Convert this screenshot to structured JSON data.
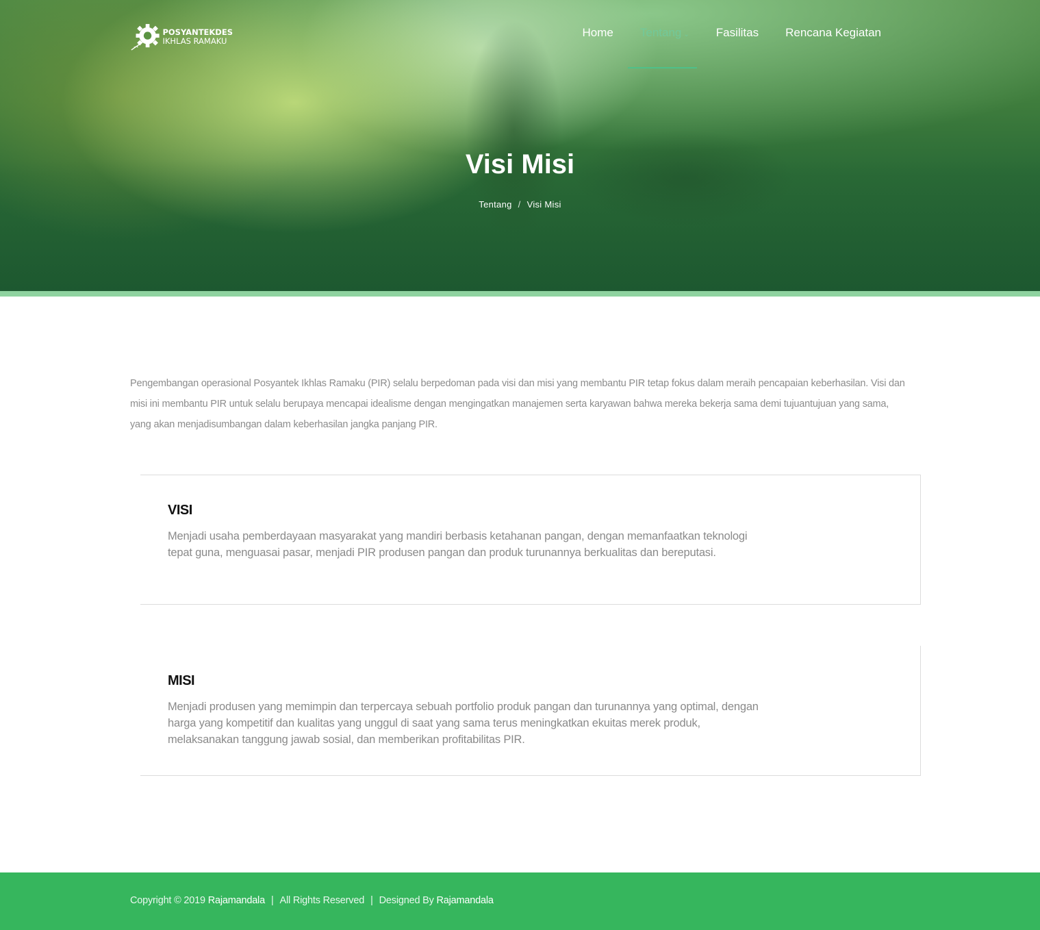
{
  "brand": {
    "line1": "POSYANTEKDES",
    "line2": "IKHLAS RAMAKU"
  },
  "nav": {
    "items": [
      {
        "label": "Home"
      },
      {
        "label": "Tentang",
        "active": true
      },
      {
        "label": "Fasilitas"
      },
      {
        "label": "Rencana Kegiatan"
      }
    ]
  },
  "hero": {
    "title": "Visi Misi",
    "breadcrumb": {
      "parent": "Tentang",
      "separator": "/",
      "current": "Visi Misi"
    }
  },
  "intro": {
    "text": "Pengembangan operasional Posyantek Ikhlas Ramaku (PIR) selalu berpedoman pada visi dan misi yang membantu PIR tetap fokus dalam meraih pencapaian keberhasilan. Visi dan misi ini membantu PIR untuk selalu berupaya mencapai idealisme dengan mengingatkan manajemen serta karyawan bahwa mereka bekerja sama demi tujuantujuan yang sama, yang akan menjadisumbangan dalam keberhasilan jangka panjang PIR."
  },
  "visi": {
    "heading": "VISI",
    "text": "Menjadi usaha pemberdayaan masyarakat yang mandiri berbasis ketahanan pangan, dengan memanfaatkan teknologi tepat guna, menguasai pasar, menjadi PIR produsen pangan dan produk turunannya berkualitas dan bereputasi."
  },
  "misi": {
    "heading": "MISI",
    "text": "Menjadi produsen yang memimpin dan terpercaya sebuah portfolio produk pangan dan turunannya yang optimal, dengan harga yang kompetitif dan kualitas yang unggul di saat yang sama terus meningkatkan ekuitas merek produk, melaksanakan tanggung jawab sosial, dan memberikan profitabilitas PIR."
  },
  "footer": {
    "copyright": "Copyright © 2019",
    "company": "Rajamandala",
    "separator": "|",
    "rights": "All Rights Reserved",
    "designed_by": "Designed By",
    "designer": "Rajamandala"
  },
  "colors": {
    "accent": "#4fc08a",
    "footer_bg": "#36b65d",
    "hero_dark": "#226234"
  }
}
